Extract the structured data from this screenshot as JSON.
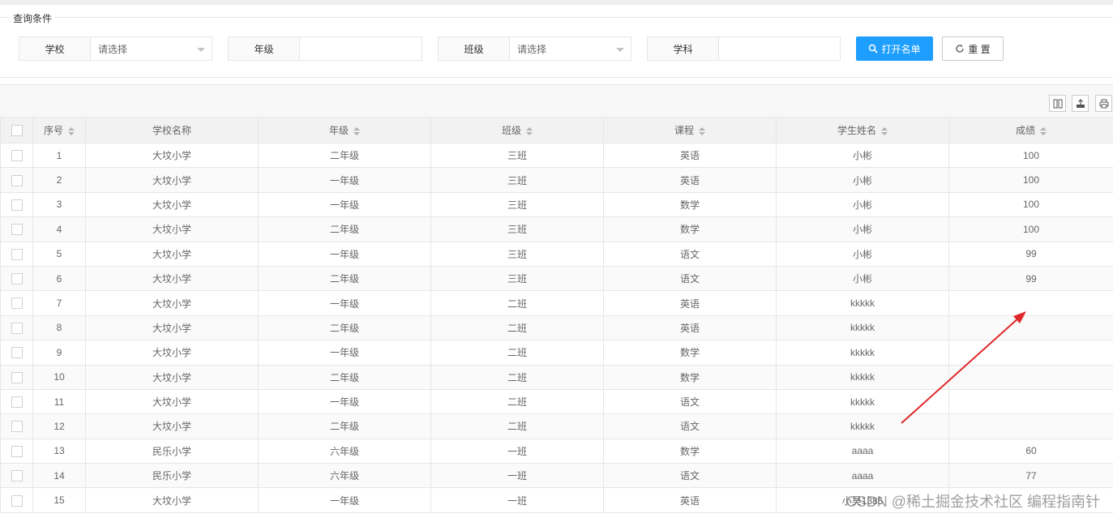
{
  "query": {
    "legend": "查询条件",
    "fields": [
      {
        "label": "学校",
        "value": "请选择",
        "type": "select"
      },
      {
        "label": "年级",
        "value": "",
        "type": "text"
      },
      {
        "label": "班级",
        "value": "请选择",
        "type": "select"
      },
      {
        "label": "学科",
        "value": "",
        "type": "text"
      }
    ],
    "open_button": "打开名单",
    "reset_button": "重 置"
  },
  "toolbar": {
    "icons": [
      "columns-filter-icon",
      "export-icon",
      "print-icon"
    ]
  },
  "table": {
    "columns": [
      "序号",
      "学校名称",
      "年级",
      "班级",
      "课程",
      "学生姓名",
      "成绩"
    ],
    "rows": [
      [
        "1",
        "大坟小学",
        "二年级",
        "三班",
        "英语",
        "小彬",
        "100"
      ],
      [
        "2",
        "大坟小学",
        "一年级",
        "三班",
        "英语",
        "小彬",
        "100"
      ],
      [
        "3",
        "大坟小学",
        "一年级",
        "三班",
        "数学",
        "小彬",
        "100"
      ],
      [
        "4",
        "大坟小学",
        "二年级",
        "三班",
        "数学",
        "小彬",
        "100"
      ],
      [
        "5",
        "大坟小学",
        "一年级",
        "三班",
        "语文",
        "小彬",
        "99"
      ],
      [
        "6",
        "大坟小学",
        "二年级",
        "三班",
        "语文",
        "小彬",
        "99"
      ],
      [
        "7",
        "大坟小学",
        "一年级",
        "二班",
        "英语",
        "kkkkk",
        ""
      ],
      [
        "8",
        "大坟小学",
        "二年级",
        "二班",
        "英语",
        "kkkkk",
        ""
      ],
      [
        "9",
        "大坟小学",
        "一年级",
        "二班",
        "数学",
        "kkkkk",
        ""
      ],
      [
        "10",
        "大坟小学",
        "二年级",
        "二班",
        "数学",
        "kkkkk",
        ""
      ],
      [
        "11",
        "大坟小学",
        "一年级",
        "二班",
        "语文",
        "kkkkk",
        ""
      ],
      [
        "12",
        "大坟小学",
        "二年级",
        "二班",
        "语文",
        "kkkkk",
        ""
      ],
      [
        "13",
        "民乐小学",
        "六年级",
        "一班",
        "数学",
        "aaaa",
        "60"
      ],
      [
        "14",
        "民乐小学",
        "六年级",
        "一班",
        "语文",
        "aaaa",
        "77"
      ],
      [
        "15",
        "大坟小学",
        "一年级",
        "一班",
        "英语",
        "小昊1385",
        ""
      ]
    ]
  },
  "annotation": {
    "arrow_color": "#e0272b"
  },
  "watermark": "CSDN @稀土掘金技术社区 编程指南针",
  "colors": {
    "primary": "#1e9fff"
  }
}
